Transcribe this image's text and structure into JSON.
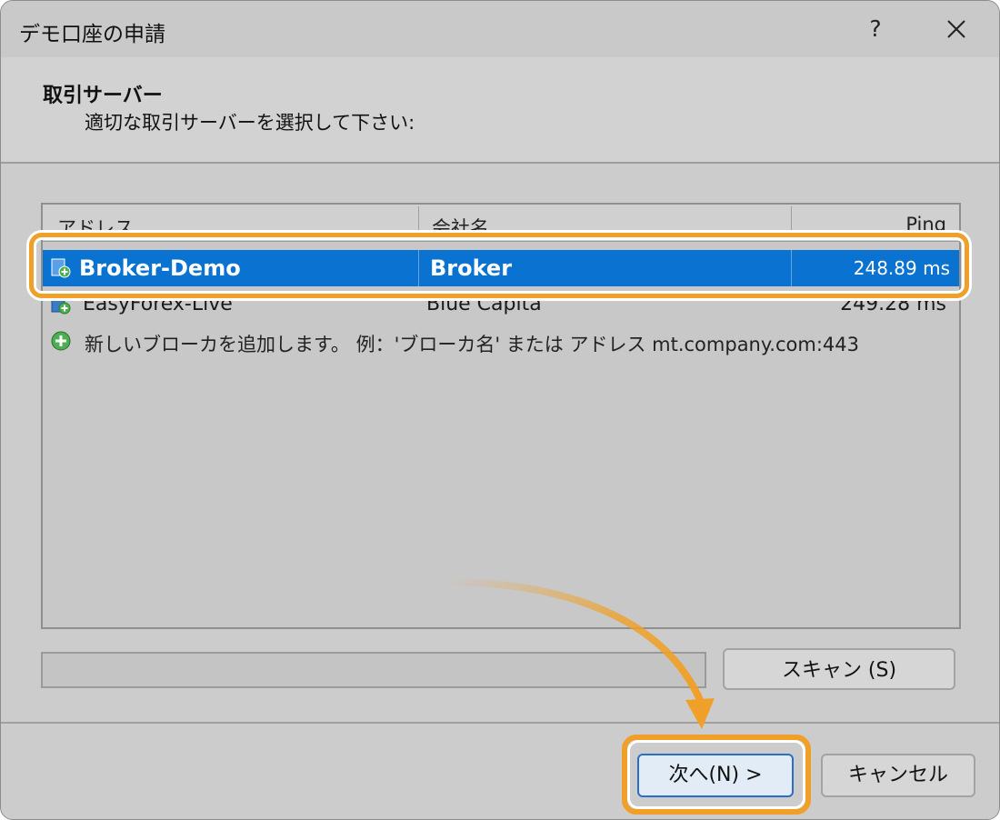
{
  "window": {
    "title": "デモ口座の申請",
    "help_label": "?"
  },
  "header": {
    "title": "取引サーバー",
    "subtitle": "適切な取引サーバーを選択して下さい:"
  },
  "table": {
    "columns": [
      "アドレス",
      "会社名",
      "Ping"
    ],
    "rows": [
      {
        "address": "Broker-Demo",
        "company": "Broker",
        "ping": "248.89 ms",
        "selected": true
      },
      {
        "address": "EasyForex-Live",
        "company": "Blue Capita",
        "ping": "249.28 ms",
        "selected": false
      }
    ],
    "add_row_text": "新しいブローカを追加します。  例：'ブローカ名' または アドレス mt.company.com:443"
  },
  "buttons": {
    "scan": "スキャン (S)",
    "next": "次へ(N) >",
    "cancel": "キャンセル"
  },
  "colors": {
    "selection": "#0a72d0",
    "highlight": "#f0a028"
  }
}
